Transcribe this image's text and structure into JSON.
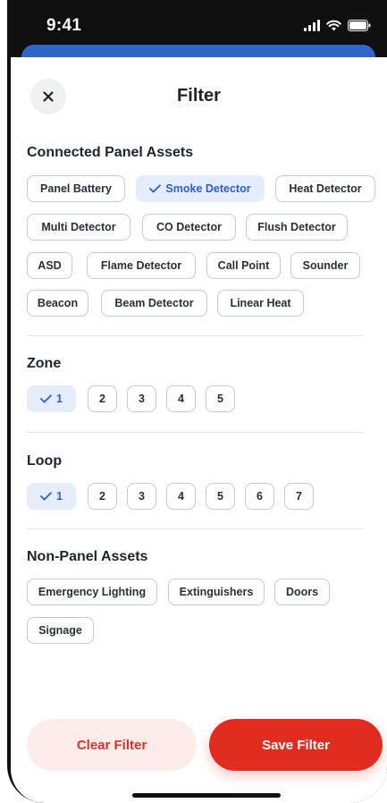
{
  "status_bar": {
    "time": "9:41"
  },
  "header": {
    "title": "Filter"
  },
  "sections": {
    "connected": {
      "title": "Connected Panel Assets",
      "chips": [
        "Panel Battery",
        "Smoke Detector",
        "Heat Detector",
        "Multi Detector",
        "CO Detector",
        "Flush Detector",
        "ASD",
        "Flame Detector",
        "Call Point",
        "Sounder",
        "Beacon",
        "Beam Detector",
        "Linear Heat"
      ],
      "selected": "Smoke Detector"
    },
    "zone": {
      "title": "Zone",
      "chips": [
        "1",
        "2",
        "3",
        "4",
        "5"
      ],
      "selected": "1"
    },
    "loop": {
      "title": "Loop",
      "chips": [
        "1",
        "2",
        "3",
        "4",
        "5",
        "6",
        "7"
      ],
      "selected": "1"
    },
    "non_panel": {
      "title": "Non-Panel Assets",
      "chips": [
        "Emergency Lighting",
        "Extinguishers",
        "Doors",
        "Signage"
      ]
    }
  },
  "actions": {
    "clear": "Clear Filter",
    "save": "Save Filter"
  },
  "colors": {
    "accent_blue": "#2d5fd0",
    "selected_bg": "#e5edfb",
    "primary_red": "#e02d20",
    "secondary_red_bg": "#fdecea"
  }
}
